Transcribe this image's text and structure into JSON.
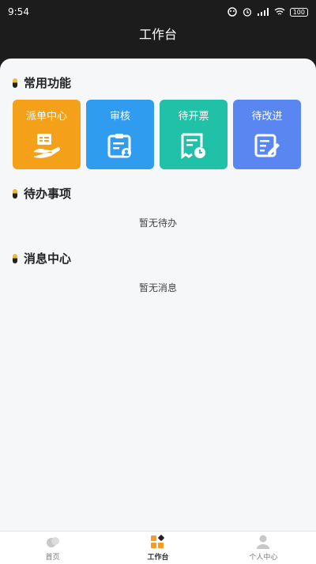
{
  "status": {
    "time": "9:54",
    "battery": "100"
  },
  "header": {
    "title": "工作台"
  },
  "sections": {
    "common": {
      "title": "常用功能"
    },
    "todo": {
      "title": "待办事项",
      "empty": "暂无待办"
    },
    "messages": {
      "title": "消息中心",
      "empty": "暂无消息"
    }
  },
  "cards": [
    {
      "label": "派单中心",
      "icon": "dispatch-hand-icon",
      "color": "#f5a019"
    },
    {
      "label": "审核",
      "icon": "review-clipboard-icon",
      "color": "#2f9cf0"
    },
    {
      "label": "待开票",
      "icon": "invoice-clock-icon",
      "color": "#21c1a8"
    },
    {
      "label": "待改进",
      "icon": "improve-edit-icon",
      "color": "#5a86f2"
    }
  ],
  "tabs": [
    {
      "label": "首页",
      "icon": "home-icon"
    },
    {
      "label": "工作台",
      "icon": "workbench-icon"
    },
    {
      "label": "个人中心",
      "icon": "user-icon"
    }
  ]
}
